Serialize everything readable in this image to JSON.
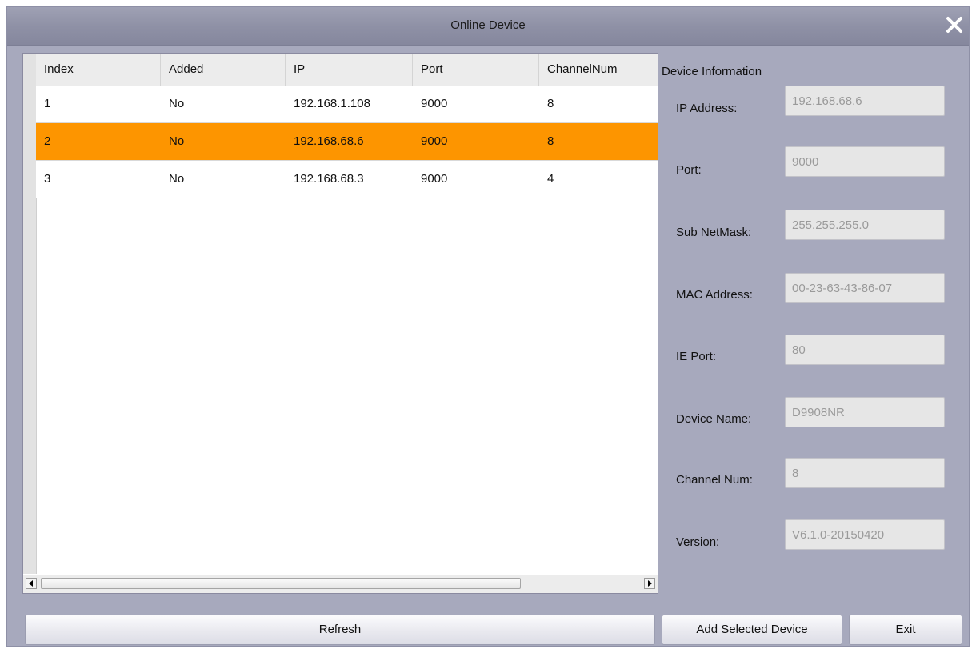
{
  "window": {
    "title": "Online Device"
  },
  "table": {
    "columns": [
      "Index",
      "Added",
      "IP",
      "Port",
      "ChannelNum"
    ],
    "rows": [
      {
        "index": "1",
        "added": "No",
        "ip": "192.168.1.108",
        "port": "9000",
        "channels": "8",
        "selected": false
      },
      {
        "index": "2",
        "added": "No",
        "ip": "192.168.68.6",
        "port": "9000",
        "channels": "8",
        "selected": true
      },
      {
        "index": "3",
        "added": "No",
        "ip": "192.168.68.3",
        "port": "9000",
        "channels": "4",
        "selected": false
      }
    ],
    "scroll_left_icon": "arrow-left-icon",
    "scroll_right_icon": "arrow-right-icon"
  },
  "device_info": {
    "title": "Device Information",
    "fields": [
      {
        "label": "IP Address:",
        "value": "192.168.68.6"
      },
      {
        "label": "Port:",
        "value": "9000"
      },
      {
        "label": "Sub NetMask:",
        "value": "255.255.255.0"
      },
      {
        "label": "MAC Address:",
        "value": "00-23-63-43-86-07"
      },
      {
        "label": "IE Port:",
        "value": "80"
      },
      {
        "label": "Device Name:",
        "value": "D9908NR"
      },
      {
        "label": "Channel Num:",
        "value": "8"
      },
      {
        "label": "Version:",
        "value": "V6.1.0-20150420"
      }
    ]
  },
  "buttons": {
    "refresh": "Refresh",
    "add_selected": "Add Selected Device",
    "exit": "Exit"
  },
  "colors": {
    "selected_row": "#fd9500",
    "dialog_bg": "#a7a9bd"
  },
  "icons": {
    "close": "close-icon"
  }
}
